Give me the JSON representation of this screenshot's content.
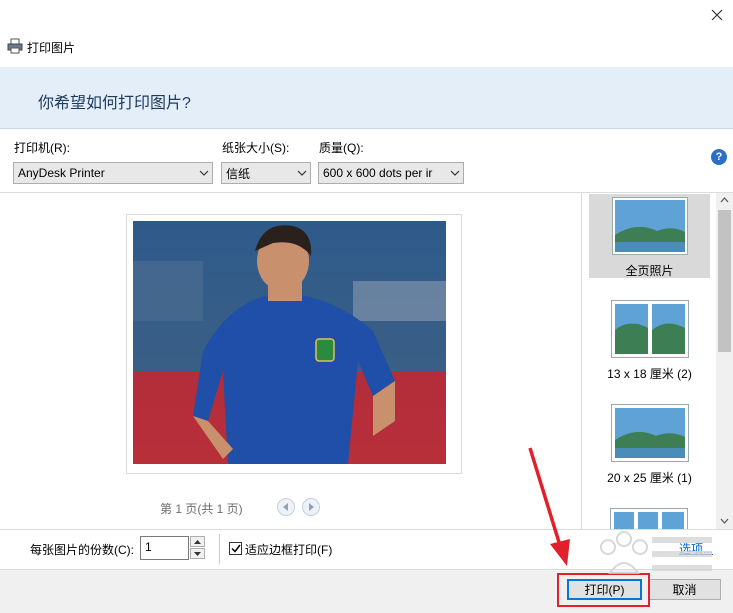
{
  "window": {
    "title": "打印图片",
    "close_glyph": "✕",
    "icon": "printer-icon"
  },
  "header": {
    "question": "你希望如何打印图片?"
  },
  "settings": {
    "printer": {
      "label": "打印机(R):",
      "value": "AnyDesk Printer"
    },
    "paper_size": {
      "label": "纸张大小(S):",
      "value": "信纸"
    },
    "quality": {
      "label": "质量(Q):",
      "value": "600 x 600 dots per ir"
    },
    "help_glyph": "?"
  },
  "preview": {
    "page_info": "第 1 页(共 1 页)"
  },
  "layouts": [
    {
      "caption": "全页照片",
      "selected": true
    },
    {
      "caption": "13 x 18 厘米 (2)",
      "selected": false
    },
    {
      "caption": "20 x 25 厘米 (1)",
      "selected": false
    }
  ],
  "bottom": {
    "copies_label": "每张图片的份数(C):",
    "copies_value": "1",
    "fit_label": "适应边框打印(F)",
    "fit_checked": true,
    "options_link": "选项..."
  },
  "buttons": {
    "print": "打印(P)",
    "cancel": "取消"
  },
  "colors": {
    "banner": "#e3eef9",
    "accent": "#0078d7",
    "highlight": "#e0202a",
    "link": "#0066cc"
  }
}
